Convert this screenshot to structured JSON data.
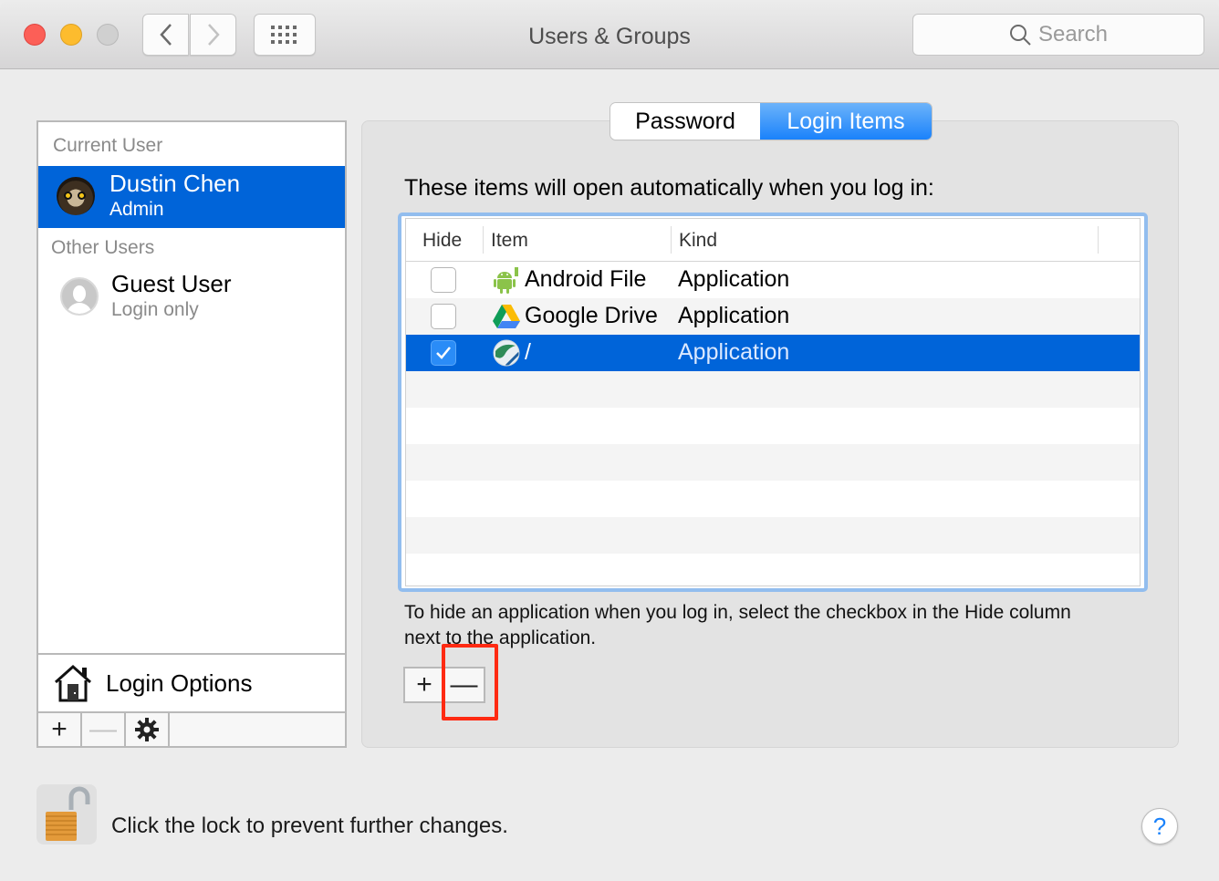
{
  "window": {
    "title": "Users & Groups",
    "search_placeholder": "Search"
  },
  "sidebar": {
    "current_user_label": "Current User",
    "current_user": {
      "name": "Dustin Chen",
      "role": "Admin",
      "selected": true
    },
    "other_users_label": "Other Users",
    "other_users": [
      {
        "name": "Guest User",
        "role": "Login only"
      }
    ],
    "login_options_label": "Login Options",
    "toolbar": {
      "add": "+",
      "remove": "—",
      "gear": "⚙"
    }
  },
  "tabs": [
    {
      "label": "Password",
      "active": false
    },
    {
      "label": "Login Items",
      "active": true
    }
  ],
  "login_items": {
    "intro": "These items will open automatically when you log in:",
    "columns": [
      "Hide",
      "Item",
      "Kind"
    ],
    "rows": [
      {
        "hide": false,
        "item": "Android File",
        "kind": "Application",
        "icon": "android-icon",
        "selected": false
      },
      {
        "hide": false,
        "item": "Google Drive",
        "kind": "Application",
        "icon": "google-drive-icon",
        "selected": false
      },
      {
        "hide": true,
        "item": "/",
        "kind": "Application",
        "icon": "globe-app-icon",
        "selected": true
      }
    ],
    "help_text": "To hide an application when you log in, select the checkbox in the Hide column next to the application.",
    "add_label": "+",
    "remove_label": "—"
  },
  "footer": {
    "lock_text": "Click the lock to prevent further changes.",
    "help_label": "?"
  },
  "colors": {
    "selection": "#0064d9",
    "tab_active": "#1a82fb",
    "highlight": "#ff2a12"
  }
}
